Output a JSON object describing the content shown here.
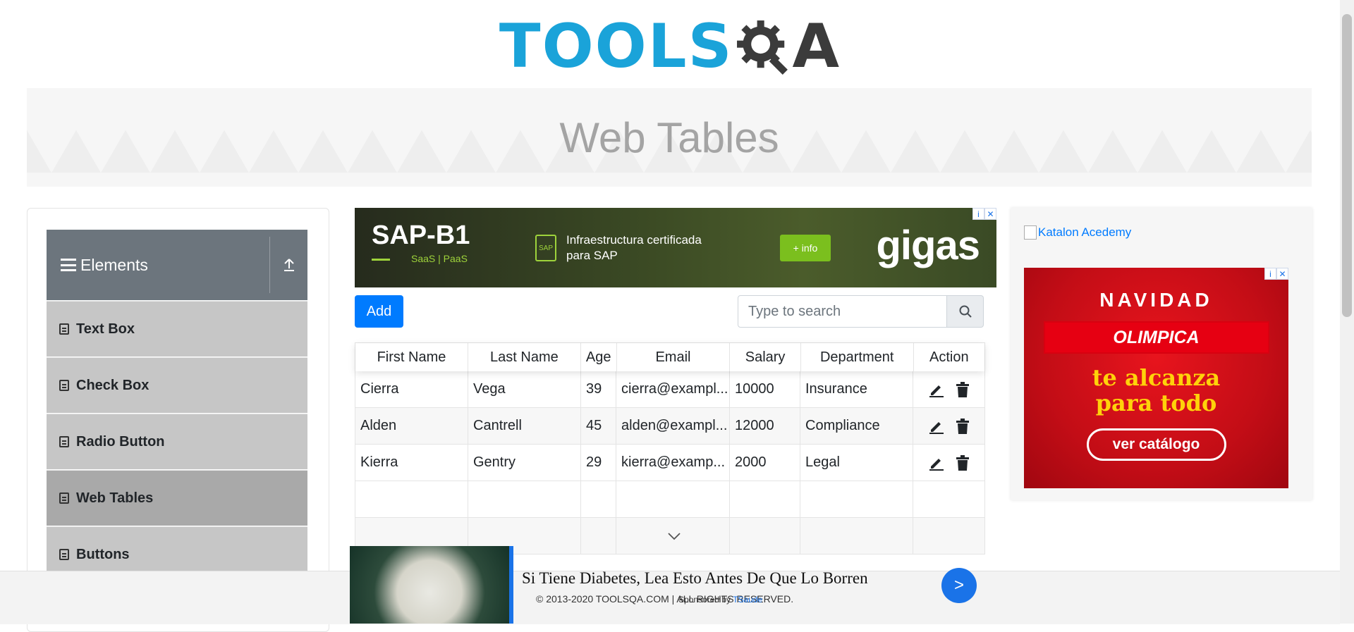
{
  "logo": {
    "part1": "TOOLS",
    "part2": "A"
  },
  "page_title": "Web Tables",
  "sidebar": {
    "group_title": "Elements",
    "items": [
      {
        "label": "Text Box"
      },
      {
        "label": "Check Box"
      },
      {
        "label": "Radio Button"
      },
      {
        "label": "Web Tables",
        "active": true
      },
      {
        "label": "Buttons"
      }
    ]
  },
  "top_ad": {
    "brand": "SAP-B1",
    "sub": "SaaS | PaaS",
    "text": "Infraestructura certificada para SAP",
    "doc_label": "SAP",
    "cta": "+ info",
    "company": "gigas"
  },
  "toolbar": {
    "add_label": "Add",
    "search_placeholder": "Type to search"
  },
  "table": {
    "columns": [
      "First Name",
      "Last Name",
      "Age",
      "Email",
      "Salary",
      "Department",
      "Action"
    ],
    "rows": [
      [
        "Cierra",
        "Vega",
        "39",
        "cierra@exampl...",
        "10000",
        "Insurance"
      ],
      [
        "Alden",
        "Cantrell",
        "45",
        "alden@exampl...",
        "12000",
        "Compliance"
      ],
      [
        "Kierra",
        "Gentry",
        "29",
        "kierra@examp...",
        "2000",
        "Legal"
      ]
    ]
  },
  "right_ad": {
    "katalon_alt": "Katalon Acedemy",
    "headline": "NAVIDAD",
    "brand": "OLIMPICA",
    "slogan_1": "te alcanza",
    "slogan_2": "para todo",
    "cta": "ver catálogo"
  },
  "footer": {
    "copyright": "© 2013-2020 TOOLSQA.COM | ALL RIGHTS RESERVED."
  },
  "bottom_ad": {
    "headline": "Si Tiene Diabetes, Lea Esto Antes De Que Lo Borren",
    "sponsor_prefix": "Sponsored by",
    "sponsor_name": "TSaude",
    "go_label": ">"
  },
  "colors": {
    "primary": "#007bff",
    "header_gray": "#6c757d",
    "logo_blue": "#1aa3d9"
  },
  "icons": [
    "hamburger-icon",
    "upload-icon",
    "document-icon",
    "search-icon",
    "edit-icon",
    "delete-icon",
    "chevron-down-icon"
  ]
}
